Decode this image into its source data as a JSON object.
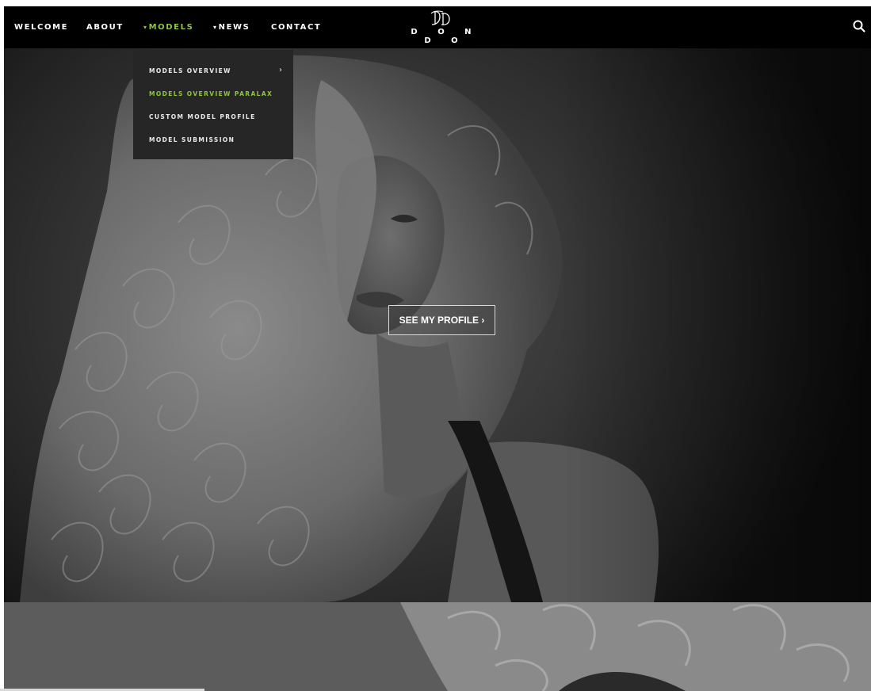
{
  "nav": {
    "items": [
      {
        "label": "WELCOME",
        "active": false,
        "caret": false
      },
      {
        "label": "ABOUT",
        "active": false,
        "caret": false
      },
      {
        "label": "MODELS",
        "active": true,
        "caret": true
      },
      {
        "label": "NEWS",
        "active": false,
        "caret": true
      },
      {
        "label": "CONTACT",
        "active": false,
        "caret": false
      }
    ],
    "caret_glyph": "▾",
    "logo_text": "D O N D O",
    "search_icon": "search-icon"
  },
  "dropdown": {
    "items": [
      {
        "label": "MODELS OVERVIEW",
        "active": false,
        "has_submenu": true
      },
      {
        "label": "MODELS OVERVIEW PARALAX",
        "active": true,
        "has_submenu": false
      },
      {
        "label": "CUSTOM MODEL PROFILE",
        "active": false,
        "has_submenu": false
      },
      {
        "label": "MODEL SUBMISSION",
        "active": false,
        "has_submenu": false
      }
    ],
    "submenu_arrow": "›"
  },
  "hero": {
    "button_label": "SEE MY PROFILE ›"
  },
  "colors": {
    "accent": "#8cc63f",
    "nav_bg": "#000000",
    "dropdown_bg": "#262626"
  }
}
